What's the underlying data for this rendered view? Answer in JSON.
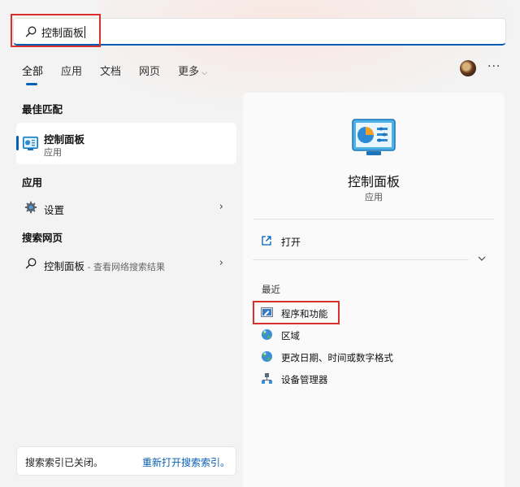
{
  "search": {
    "query": "控制面板"
  },
  "tabs": [
    {
      "label": "全部",
      "active": true
    },
    {
      "label": "应用",
      "active": false
    },
    {
      "label": "文档",
      "active": false
    },
    {
      "label": "网页",
      "active": false
    },
    {
      "label": "更多",
      "active": false
    }
  ],
  "more_options": "···",
  "left": {
    "best_match_title": "最佳匹配",
    "best_match": {
      "name": "控制面板",
      "type": "应用",
      "icon": "control-panel-icon"
    },
    "apps_title": "应用",
    "apps": [
      {
        "label": "设置",
        "icon": "gear-icon"
      }
    ],
    "web_title": "搜索网页",
    "web": [
      {
        "label": "控制面板",
        "sub": " - 查看网络搜索结果",
        "icon": "search-icon"
      }
    ],
    "status": {
      "message": "搜索索引已关闭。",
      "link": "重新打开搜索索引。"
    }
  },
  "right": {
    "title": "控制面板",
    "type": "应用",
    "open_label": "打开",
    "recent_title": "最近",
    "recent": [
      {
        "label": "程序和功能",
        "icon": "programs-icon"
      },
      {
        "label": "区域",
        "icon": "globe-icon"
      },
      {
        "label": "更改日期、时间或数字格式",
        "icon": "globe-icon"
      },
      {
        "label": "设备管理器",
        "icon": "device-manager-icon"
      }
    ]
  },
  "colors": {
    "accent": "#005fb8",
    "highlight_box": "#d9302c",
    "link": "#0a5fb4"
  }
}
